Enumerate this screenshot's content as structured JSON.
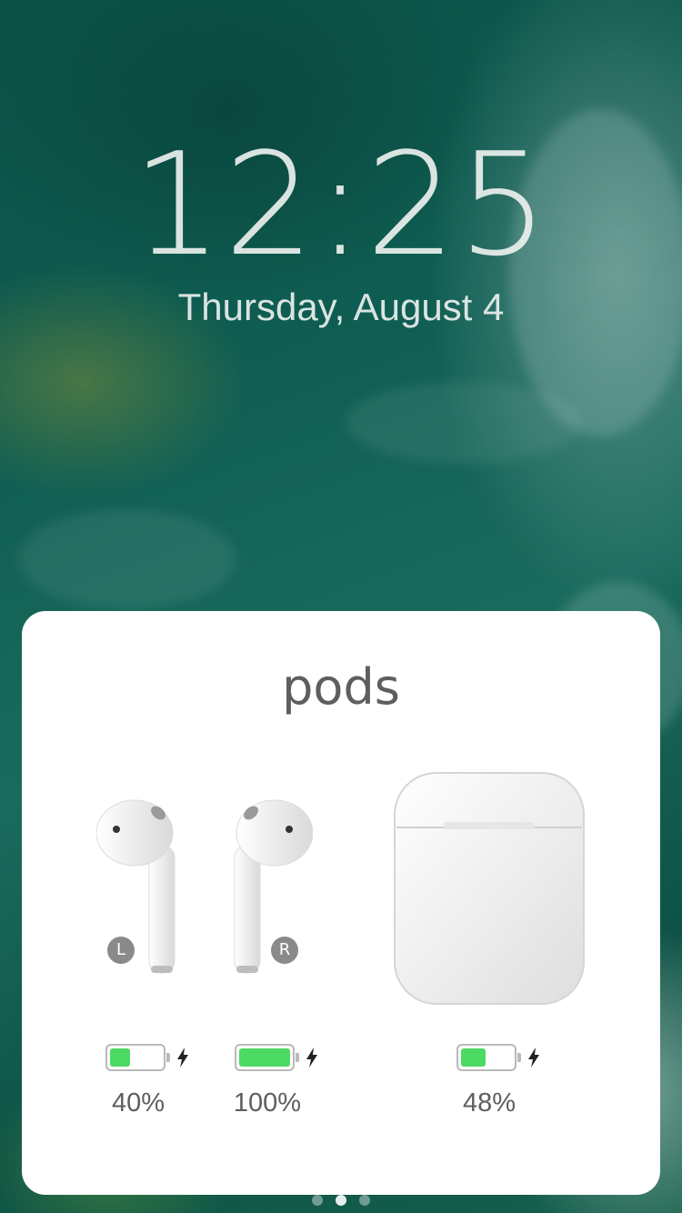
{
  "lockscreen": {
    "time": "12:25",
    "date": "Thursday, August 4"
  },
  "card": {
    "title": "pods",
    "left_pod": {
      "badge": "L",
      "battery_level": 0.4,
      "battery_label": "40%",
      "charging": true
    },
    "right_pod": {
      "badge": "R",
      "battery_level": 1.0,
      "battery_label": "100%",
      "charging": true
    },
    "case": {
      "battery_level": 0.48,
      "battery_label": "48%",
      "charging": true
    }
  },
  "colors": {
    "battery_green": "#4cd964",
    "card_text": "#5e5e5e",
    "badge_gray": "#8a8a8a"
  },
  "icons": {
    "bolt": "charging-bolt-icon"
  }
}
